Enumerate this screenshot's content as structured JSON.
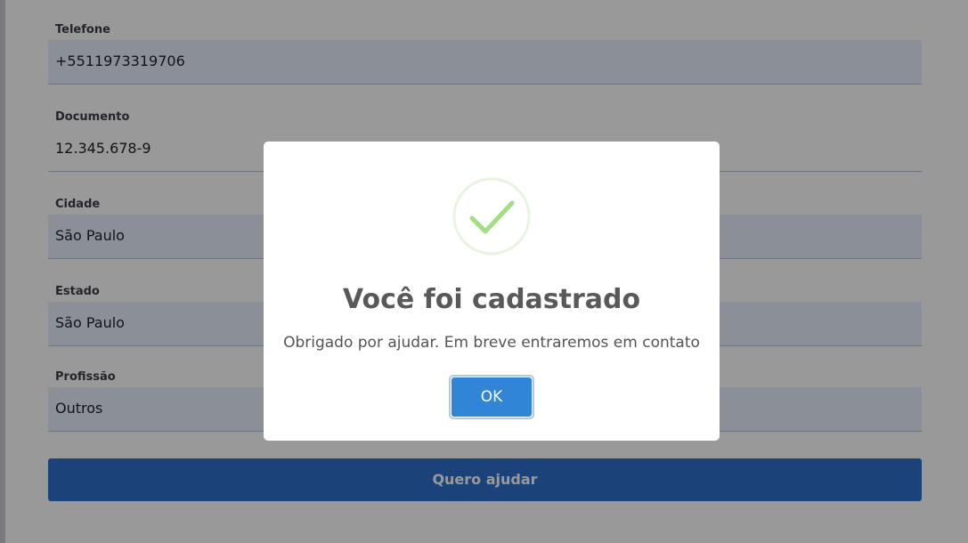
{
  "form": {
    "fields": [
      {
        "label": "Telefone",
        "value": "+5511973319706"
      },
      {
        "label": "Documento",
        "value": "12.345.678-9"
      },
      {
        "label": "Cidade",
        "value": "São Paulo"
      },
      {
        "label": "Estado",
        "value": "São Paulo"
      },
      {
        "label": "Profissão",
        "value": "Outros"
      }
    ],
    "submit_label": "Quero ajudar"
  },
  "dialog": {
    "icon": "success-check-icon",
    "title": "Você foi cadastrado",
    "text": "Obrigado por ajudar. Em breve entraremos em contato",
    "ok_label": "OK"
  },
  "colors": {
    "primary_button": "#2d70cc",
    "confirm_button": "#3085d6",
    "input_background": "#e8f0fe",
    "success_check": "#a5dc86"
  }
}
